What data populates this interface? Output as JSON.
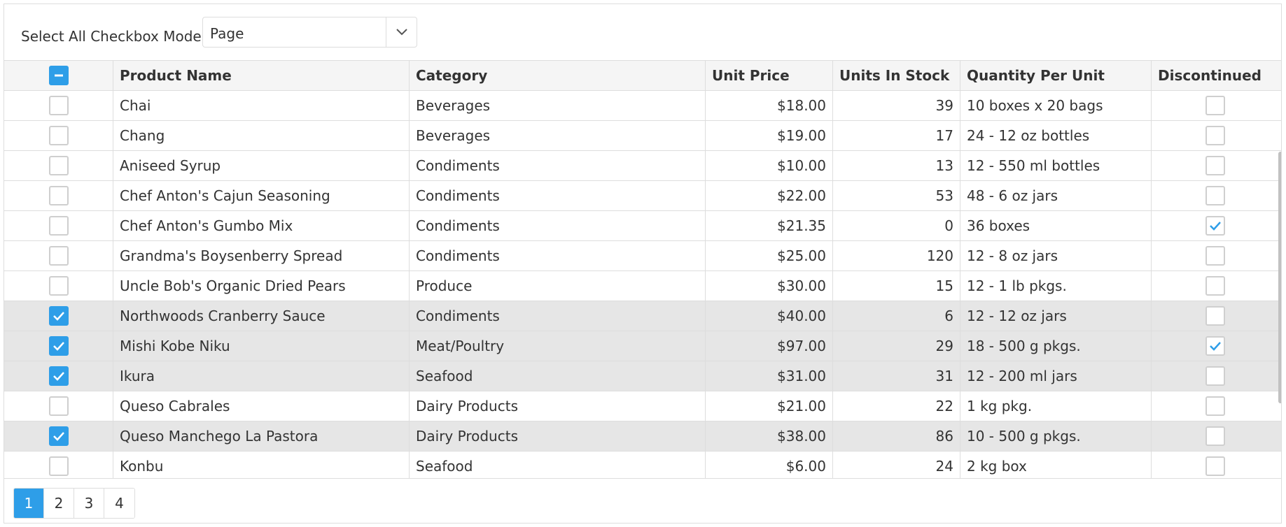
{
  "toolbar": {
    "label": "Select All Checkbox Mode:",
    "mode_value": "Page"
  },
  "columns": [
    "Product Name",
    "Category",
    "Unit Price",
    "Units In Stock",
    "Quantity Per Unit",
    "Discontinued"
  ],
  "rows": [
    {
      "name": "Chai",
      "category": "Beverages",
      "price": "$18.00",
      "stock": "39",
      "qty": "10 boxes x 20 bags",
      "selected": false,
      "discontinued": false
    },
    {
      "name": "Chang",
      "category": "Beverages",
      "price": "$19.00",
      "stock": "17",
      "qty": "24 - 12 oz bottles",
      "selected": false,
      "discontinued": false
    },
    {
      "name": "Aniseed Syrup",
      "category": "Condiments",
      "price": "$10.00",
      "stock": "13",
      "qty": "12 - 550 ml bottles",
      "selected": false,
      "discontinued": false
    },
    {
      "name": "Chef Anton's Cajun Seasoning",
      "category": "Condiments",
      "price": "$22.00",
      "stock": "53",
      "qty": "48 - 6 oz jars",
      "selected": false,
      "discontinued": false
    },
    {
      "name": "Chef Anton's Gumbo Mix",
      "category": "Condiments",
      "price": "$21.35",
      "stock": "0",
      "qty": "36 boxes",
      "selected": false,
      "discontinued": true
    },
    {
      "name": "Grandma's Boysenberry Spread",
      "category": "Condiments",
      "price": "$25.00",
      "stock": "120",
      "qty": "12 - 8 oz jars",
      "selected": false,
      "discontinued": false
    },
    {
      "name": "Uncle Bob's Organic Dried Pears",
      "category": "Produce",
      "price": "$30.00",
      "stock": "15",
      "qty": "12 - 1 lb pkgs.",
      "selected": false,
      "discontinued": false
    },
    {
      "name": "Northwoods Cranberry Sauce",
      "category": "Condiments",
      "price": "$40.00",
      "stock": "6",
      "qty": "12 - 12 oz jars",
      "selected": true,
      "discontinued": false
    },
    {
      "name": "Mishi Kobe Niku",
      "category": "Meat/Poultry",
      "price": "$97.00",
      "stock": "29",
      "qty": "18 - 500 g pkgs.",
      "selected": true,
      "discontinued": true
    },
    {
      "name": "Ikura",
      "category": "Seafood",
      "price": "$31.00",
      "stock": "31",
      "qty": "12 - 200 ml jars",
      "selected": true,
      "discontinued": false
    },
    {
      "name": "Queso Cabrales",
      "category": "Dairy Products",
      "price": "$21.00",
      "stock": "22",
      "qty": "1 kg pkg.",
      "selected": false,
      "discontinued": false
    },
    {
      "name": "Queso Manchego La Pastora",
      "category": "Dairy Products",
      "price": "$38.00",
      "stock": "86",
      "qty": "10 - 500 g pkgs.",
      "selected": true,
      "discontinued": false
    },
    {
      "name": "Konbu",
      "category": "Seafood",
      "price": "$6.00",
      "stock": "24",
      "qty": "2 kg box",
      "selected": false,
      "discontinued": false
    }
  ],
  "pager": {
    "pages": [
      "1",
      "2",
      "3",
      "4"
    ],
    "current": "1"
  },
  "colors": {
    "accent": "#2e9ee8",
    "selected_row": "#e6e6e6",
    "header_bg": "#f5f5f5",
    "border": "#dddddd"
  }
}
